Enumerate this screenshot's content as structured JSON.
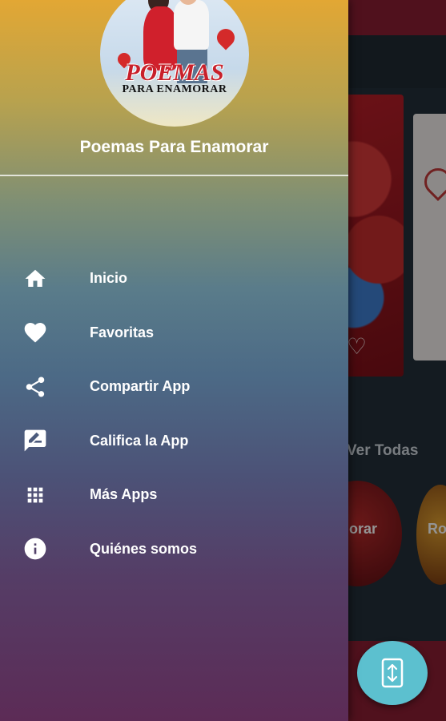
{
  "app": {
    "name": "Poemas Para Enamorar",
    "logo_title": "POEMAS",
    "logo_subtitle": "PARA ENAMORAR"
  },
  "menu": {
    "items": [
      {
        "label": "Inicio",
        "icon": "home-icon"
      },
      {
        "label": "Favoritas",
        "icon": "heart-icon"
      },
      {
        "label": "Compartir App",
        "icon": "share-icon"
      },
      {
        "label": "Califica la App",
        "icon": "rate-review-icon"
      },
      {
        "label": "Más Apps",
        "icon": "apps-grid-icon"
      },
      {
        "label": "Quiénes somos",
        "icon": "info-icon"
      }
    ]
  },
  "background": {
    "see_all_label": "Ver Todas",
    "circle_1_text": "orar",
    "circle_2_text": "Ro"
  },
  "colors": {
    "bar": "#8b1e33",
    "fab": "#5cc0cf",
    "drawer_top": "#e2a734",
    "drawer_bottom": "#5c2b56"
  }
}
